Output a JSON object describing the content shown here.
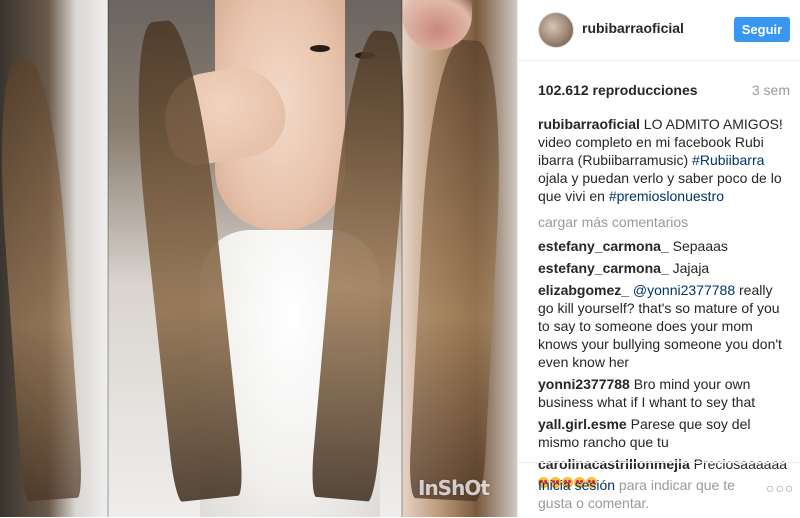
{
  "post": {
    "username": "rubibarraoficial",
    "follow_label": "Seguir",
    "views": "102.612 reproducciones",
    "age": "3 sem",
    "watermark": "InShOt",
    "caption": {
      "user": "rubibarraoficial",
      "text_1": " LO ADMITO AMIGOS! video completo en mi facebook Rubi ibarra (Rubiibarramusic) ",
      "tag_1": "#Rubiibarra",
      "text_2": " ojala y puedan verlo y saber poco de lo que vivi en ",
      "tag_2": "#premioslonuestro"
    },
    "load_more": "cargar más comentarios",
    "comments": [
      {
        "user": "estefany_carmona_",
        "text": " Sepaaas"
      },
      {
        "user": "estefany_carmona_",
        "text": " Jajaja"
      },
      {
        "user": "elizabgomez_",
        "mention": "@yonni2377788",
        "text": " really go kill yourself? that's so mature of you to say to someone does your mom knows your bullying someone you don't even know her"
      },
      {
        "user": "yonni2377788",
        "text": " Bro mind your own business what if I whant to sey that"
      },
      {
        "user": "yall.girl.esme",
        "text": " Parese que soy del mismo rancho que tu"
      },
      {
        "user": "carolinacastrillonmejia",
        "text": " Preciosaaaaaa"
      }
    ],
    "emoji_name": "heart-eyes-emoji",
    "login": {
      "link": "Inicia sesión",
      "text": " para indicar que te gusta o comentar."
    },
    "more_label": "○○○"
  }
}
